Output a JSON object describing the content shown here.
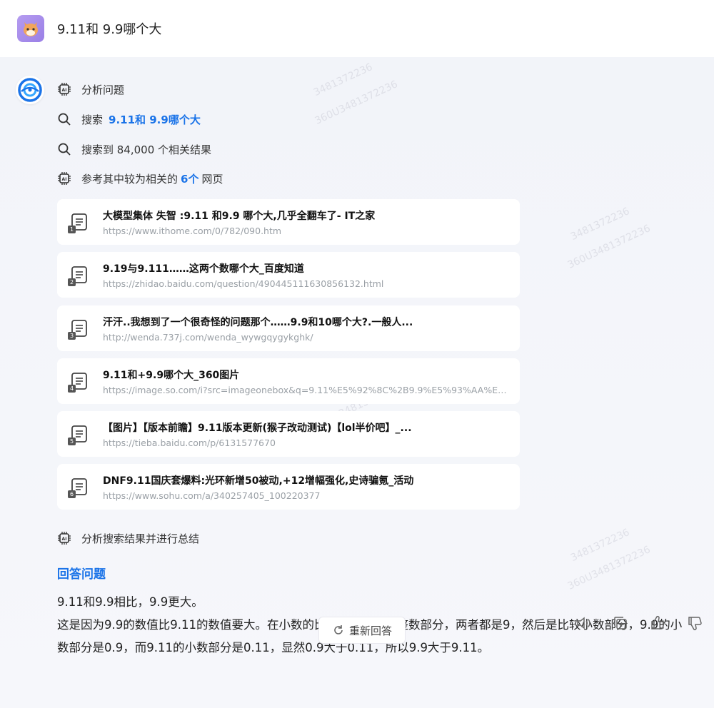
{
  "header": {
    "question": "9.11和 9.9哪个大"
  },
  "steps": [
    {
      "icon": "ai-chip-icon",
      "label": "分析问题"
    },
    {
      "icon": "search-icon",
      "label": "搜索",
      "highlight": "9.11和 9.9哪个大"
    },
    {
      "icon": "search-icon",
      "label": "搜索到 84,000 个相关结果"
    },
    {
      "icon": "ai-chip-icon",
      "label_pre": "参考其中较为相关的",
      "highlight": "6个",
      "label_post": "网页"
    }
  ],
  "sources": [
    {
      "num": "1",
      "title": "大模型集体 失智 :9.11 和9.9 哪个大,几乎全翻车了- IT之家",
      "url": "https://www.ithome.com/0/782/090.htm"
    },
    {
      "num": "2",
      "title": "9.19与9.111……这两个数哪个大_百度知道",
      "url": "https://zhidao.baidu.com/question/490445111630856132.html"
    },
    {
      "num": "3",
      "title": "汗汗..我想到了一个很奇怪的问题那个……9.9和10哪个大?.一般人...",
      "url": "http://wenda.737j.com/wenda_wywgqygykghk/"
    },
    {
      "num": "4",
      "title": "9.11和+9.9哪个大_360图片",
      "url": "https://image.so.com/i?src=imageonebox&q=9.11%E5%92%8C%2B9.9%E5%93%AA%E4%..."
    },
    {
      "num": "5",
      "title": "【图片】【版本前瞻】9.11版本更新(猴子改动测试)【lol半价吧】_...",
      "url": "https://tieba.baidu.com/p/6131577670"
    },
    {
      "num": "6",
      "title": "DNF9.11国庆套爆料:光环新增50被动,+12增幅强化,史诗骗氪_活动",
      "url": "https://www.sohu.com/a/340257405_100220377"
    }
  ],
  "summary_step": {
    "icon": "ai-chip-icon",
    "label": "分析搜索结果并进行总结"
  },
  "answer": {
    "title": "回答问题",
    "line1": "9.11和9.9相比，9.9更大。",
    "paragraph": "这是因为9.9的数值比9.11的数值要大。在小数的比较中，首先是整数部分，两者都是9，然后是比较小数部分，9.9的小数部分是0.9，而9.11的小数部分是0.11，显然0.9大于0.11，所以9.9大于9.11。"
  },
  "footer": {
    "regenerate_label": "重新回答",
    "actions": [
      "speaker-icon",
      "copy-icon",
      "thumbs-up-icon",
      "thumbs-down-icon"
    ]
  },
  "watermarks": [
    "3481372236",
    "360U3481372236"
  ],
  "colors": {
    "accent": "#1a73e8",
    "background": "#f2f4f9",
    "card": "#ffffff",
    "url": "#9aa0a6"
  }
}
